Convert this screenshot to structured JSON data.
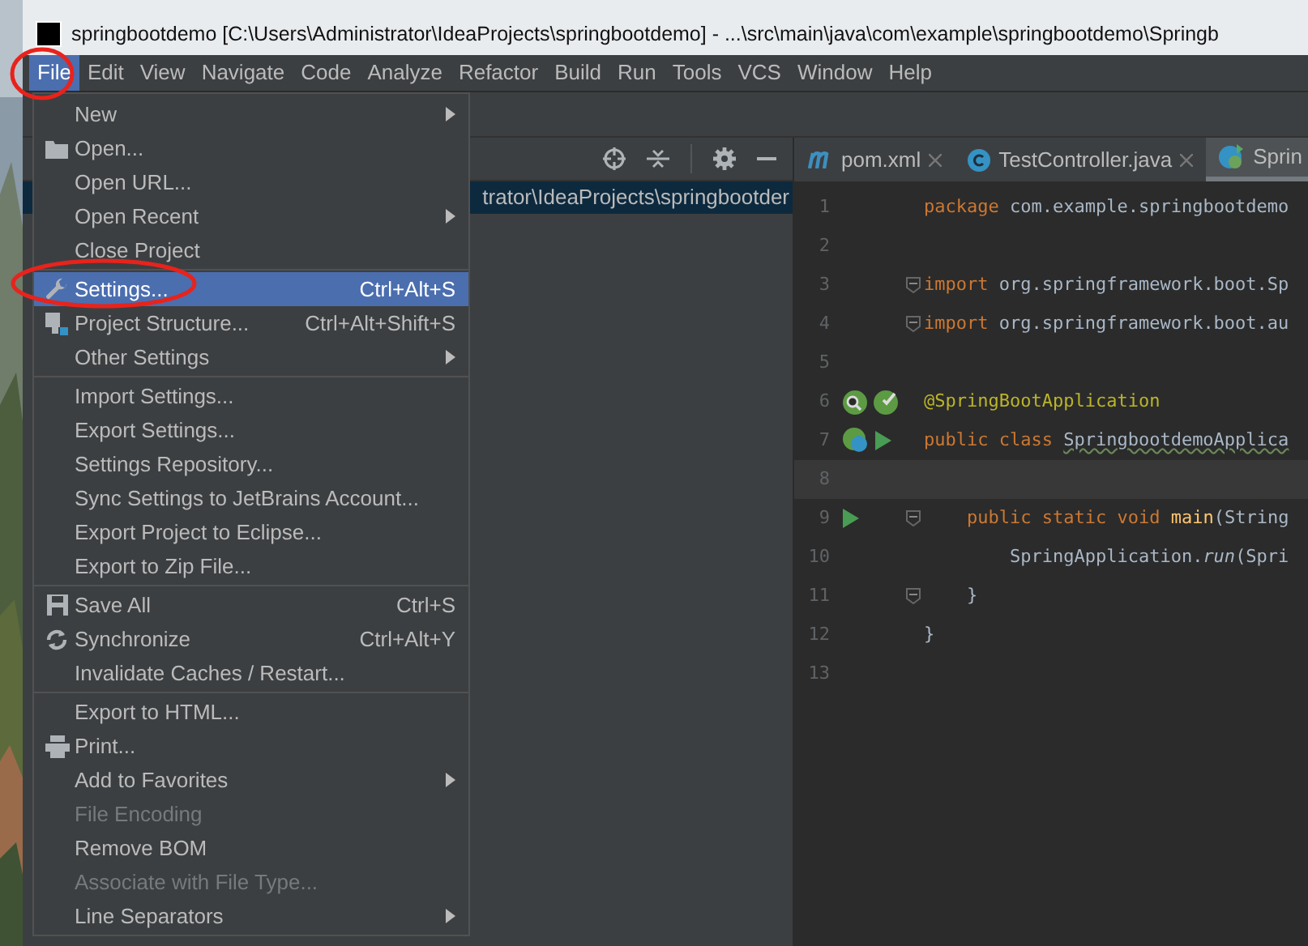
{
  "window": {
    "title": "springbootdemo [C:\\Users\\Administrator\\IdeaProjects\\springbootdemo] - ...\\src\\main\\java\\com\\example\\springbootdemo\\Springb"
  },
  "menu_bar": [
    {
      "label": "File",
      "selected": true
    },
    {
      "label": "Edit",
      "selected": false
    },
    {
      "label": "View",
      "selected": false
    },
    {
      "label": "Navigate",
      "selected": false
    },
    {
      "label": "Code",
      "selected": false
    },
    {
      "label": "Analyze",
      "selected": false
    },
    {
      "label": "Refactor",
      "selected": false
    },
    {
      "label": "Build",
      "selected": false
    },
    {
      "label": "Run",
      "selected": false
    },
    {
      "label": "Tools",
      "selected": false
    },
    {
      "label": "VCS",
      "selected": false
    },
    {
      "label": "Window",
      "selected": false
    },
    {
      "label": "Help",
      "selected": false
    }
  ],
  "file_menu": [
    [
      {
        "label": "New",
        "submenu": true,
        "selected": false,
        "disabled": false
      },
      {
        "label": "Open...",
        "kind": "folder",
        "selected": false,
        "disabled": false
      },
      {
        "label": "Open URL...",
        "selected": false,
        "disabled": false
      },
      {
        "label": "Open Recent",
        "submenu": true,
        "selected": false,
        "disabled": false
      },
      {
        "label": "Close Project",
        "selected": false,
        "disabled": false
      }
    ],
    [
      {
        "label": "Settings...",
        "kind": "wrench",
        "shortcut": "Ctrl+Alt+S",
        "selected": true,
        "disabled": false
      },
      {
        "label": "Project Structure...",
        "kind": "structure",
        "shortcut": "Ctrl+Alt+Shift+S",
        "selected": false,
        "disabled": false
      },
      {
        "label": "Other Settings",
        "submenu": true,
        "selected": false,
        "disabled": false
      }
    ],
    [
      {
        "label": "Import Settings...",
        "selected": false,
        "disabled": false
      },
      {
        "label": "Export Settings...",
        "selected": false,
        "disabled": false
      },
      {
        "label": "Settings Repository...",
        "selected": false,
        "disabled": false
      },
      {
        "label": "Sync Settings to JetBrains Account...",
        "selected": false,
        "disabled": false
      },
      {
        "label": "Export Project to Eclipse...",
        "selected": false,
        "disabled": false
      },
      {
        "label": "Export to Zip File...",
        "selected": false,
        "disabled": false
      }
    ],
    [
      {
        "label": "Save All",
        "kind": "save",
        "shortcut": "Ctrl+S",
        "selected": false,
        "disabled": false
      },
      {
        "label": "Synchronize",
        "kind": "sync",
        "shortcut": "Ctrl+Alt+Y",
        "selected": false,
        "disabled": false
      },
      {
        "label": "Invalidate Caches / Restart...",
        "selected": false,
        "disabled": false
      }
    ],
    [
      {
        "label": "Export to HTML...",
        "selected": false,
        "disabled": false
      },
      {
        "label": "Print...",
        "kind": "print",
        "selected": false,
        "disabled": false
      },
      {
        "label": "Add to Favorites",
        "submenu": true,
        "selected": false,
        "disabled": false
      },
      {
        "label": "File Encoding",
        "selected": false,
        "disabled": true
      },
      {
        "label": "Remove BOM",
        "selected": false,
        "disabled": false
      },
      {
        "label": "Associate with File Type...",
        "selected": false,
        "disabled": true
      },
      {
        "label": "Line Separators",
        "submenu": true,
        "selected": false,
        "disabled": false
      }
    ]
  ],
  "project_panel": {
    "selected_path": "trator\\IdeaProjects\\springbootder"
  },
  "editor_tabs": [
    {
      "label": "pom.xml",
      "kind": "maven",
      "closable": true,
      "selected": false
    },
    {
      "label": "TestController.java",
      "kind": "class",
      "closable": true,
      "selected": false
    },
    {
      "label": "Sprin",
      "kind": "spring",
      "closable": false,
      "selected": true
    }
  ],
  "code_lines": [
    {
      "number": "1",
      "segments": [
        {
          "kind": "keyword",
          "text": "package "
        },
        {
          "kind": "plain",
          "text": "com.example.springbootdemo"
        }
      ]
    },
    {
      "number": "2"
    },
    {
      "number": "3",
      "fold": true,
      "segments": [
        {
          "kind": "keyword",
          "text": "import "
        },
        {
          "kind": "plain",
          "text": "org.springframework.boot.Sp"
        }
      ]
    },
    {
      "number": "4",
      "fold": true,
      "segments": [
        {
          "kind": "keyword",
          "text": "import "
        },
        {
          "kind": "plain",
          "text": "org.springframework.boot.au"
        }
      ]
    },
    {
      "number": "5"
    },
    {
      "number": "6",
      "gutter": [
        {
          "kind": "bean-search"
        },
        {
          "kind": "bean-check"
        }
      ],
      "segments": [
        {
          "kind": "annotation",
          "text": "@SpringBootApplication"
        }
      ]
    },
    {
      "number": "7",
      "gutter": [
        {
          "kind": "bean-web"
        },
        {
          "kind": "run"
        }
      ],
      "segments": [
        {
          "kind": "keyword",
          "text": "public class "
        },
        {
          "kind": "warn",
          "text": "SpringbootdemoApplica"
        }
      ]
    },
    {
      "number": "8",
      "current": true
    },
    {
      "number": "9",
      "gutter": [
        {
          "kind": "run"
        }
      ],
      "fold": true,
      "segments": [
        {
          "kind": "keyword",
          "text": "    public static void "
        },
        {
          "kind": "method",
          "text": "main"
        },
        {
          "kind": "plain",
          "text": "(String"
        }
      ]
    },
    {
      "number": "10",
      "segments": [
        {
          "kind": "plain",
          "text": "        SpringApplication."
        },
        {
          "kind": "static",
          "text": "run"
        },
        {
          "kind": "plain",
          "text": "(Spri"
        }
      ]
    },
    {
      "number": "11",
      "fold": true,
      "segments": [
        {
          "kind": "plain",
          "text": "    }"
        }
      ]
    },
    {
      "number": "12",
      "segments": [
        {
          "kind": "plain",
          "text": "}"
        }
      ]
    },
    {
      "number": "13"
    }
  ]
}
